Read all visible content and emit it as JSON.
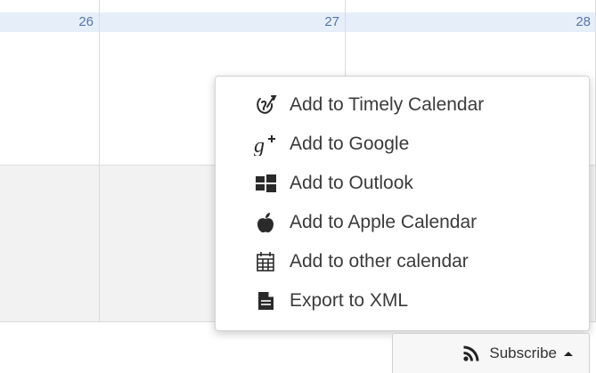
{
  "calendar": {
    "days": [
      "26",
      "27",
      "28"
    ]
  },
  "menu": {
    "items": [
      {
        "label": "Add to Timely Calendar",
        "icon": "timely-icon"
      },
      {
        "label": "Add to Google",
        "icon": "google-plus-icon"
      },
      {
        "label": "Add to Outlook",
        "icon": "windows-icon"
      },
      {
        "label": "Add to Apple Calendar",
        "icon": "apple-icon"
      },
      {
        "label": "Add to other calendar",
        "icon": "calendar-icon"
      },
      {
        "label": "Export to XML",
        "icon": "file-icon"
      }
    ]
  },
  "subscribe": {
    "label": "Subscribe",
    "icon": "rss-icon",
    "caret": "caret-up-icon"
  },
  "colors": {
    "header_bg": "#e6eefa",
    "header_text": "#5577aa",
    "menu_text": "#3b3b3b"
  }
}
